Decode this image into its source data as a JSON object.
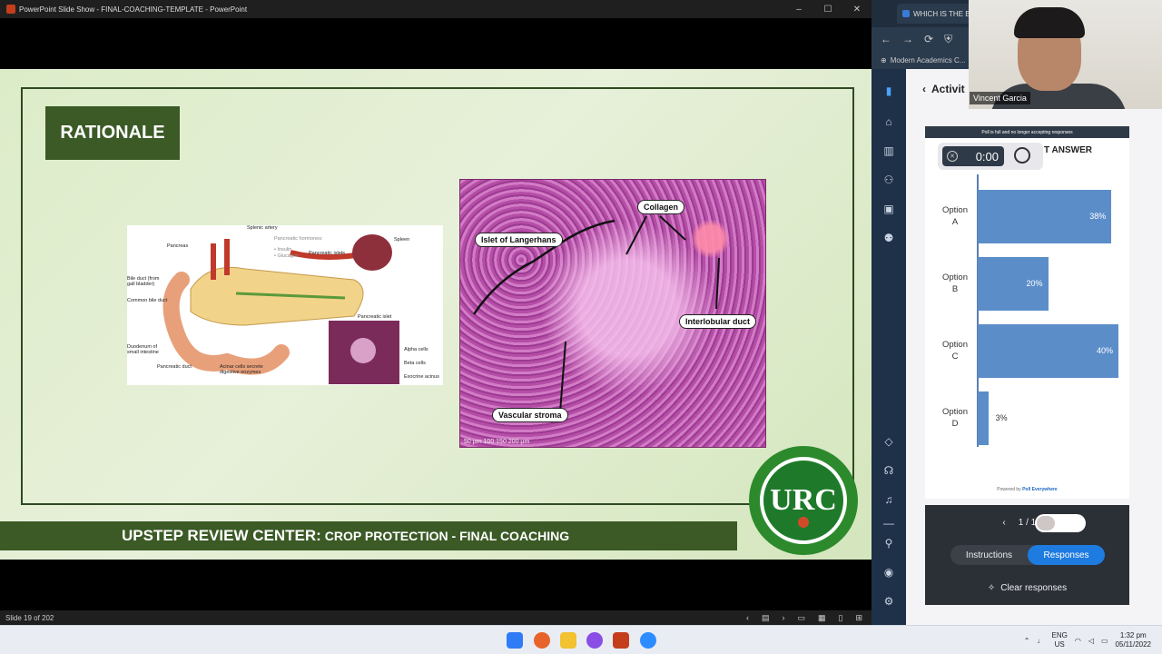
{
  "ppt": {
    "window_title": "PowerPoint Slide Show  -  FINAL-COACHING-TEMPLATE  -  PowerPoint",
    "status": "Slide 19 of 202",
    "slide": {
      "heading": "RATIONALE",
      "footer_strong": "UPSTEP REVIEW CENTER:",
      "footer_rest": "CROP PROTECTION - FINAL COACHING",
      "logo_text": "URC",
      "anatomy_labels": {
        "splenic_artery": "Splenic artery",
        "pancreas": "Pancreas",
        "pancreatic_hormones": "Pancreatic hormones:",
        "insulin": "• Insulin",
        "glucagon": "• Glucagon",
        "pancreatic_islets": "Pancreatic islets",
        "spleen": "Spleen",
        "bile_duct": "Bile duct (from gall bladder)",
        "common_bile_duct": "Common bile duct",
        "pancreatic_islet": "Pancreatic islet",
        "duodenum": "Duodenum of small intestine",
        "alpha_cells": "Alpha cells",
        "beta_cells": "Beta cells",
        "pancreatic_duct": "Pancreatic duct",
        "acinar_cells": "Acinar cells secrete digestive enzymes",
        "exocrine_acinus": "Exocrine acinus"
      },
      "histology_labels": {
        "collagen": "Collagen",
        "islet": "Islet of Langerhans",
        "interlobular": "Interlobular duct",
        "vascular": "Vascular stroma",
        "scale": "50 µm    100    150    200 µm"
      }
    }
  },
  "browser": {
    "tab_title": "WHICH IS THE B",
    "bookmark": "Modern Academics C...",
    "pe": {
      "header": "Activit",
      "poll_notice": "Poll is full and no longer accepting responses",
      "timer": "0:00",
      "title_partial": "T ANSWER",
      "powered_by": "Powered by",
      "brand": "Poll Everywhere",
      "pager": "1 / 1",
      "tab_instructions": "Instructions",
      "tab_responses": "Responses",
      "clear_responses": "Clear responses"
    }
  },
  "webcam": {
    "name": "Vincent Garcia"
  },
  "chart_data": {
    "type": "bar",
    "orientation": "horizontal",
    "categories": [
      "Option A",
      "Option B",
      "Option C",
      "Option D"
    ],
    "values": [
      38,
      20,
      40,
      3
    ],
    "value_labels": [
      "38%",
      "20%",
      "40%",
      "3%"
    ],
    "xlim": [
      0,
      40
    ],
    "bar_color": "#5b8ec9"
  },
  "taskbar": {
    "lang": "ENG",
    "region": "US",
    "time": "1:32 pm",
    "date": "05/11/2022"
  }
}
